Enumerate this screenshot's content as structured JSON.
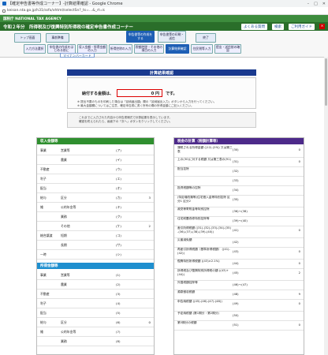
{
  "window": {
    "title": "【確定申告書等作成コーナー】-計算結果確認 - Google Chrome",
    "url": "keisan.nta.go.jp/h31/ssfo/xhtml/selectSn?_ts=...&_rt=k"
  },
  "agency": "国税庁 NATIONAL TAX AGENCY",
  "app": {
    "title": "令和２年分　所得税及び復興特別所得税の確定申告書作成コーナー",
    "faq": "よくある質問",
    "search_label": "検索",
    "help": "ご利用ガイド"
  },
  "steps": {
    "top": [
      "トップ画面",
      "事前準備",
      "申告書等の作成をする",
      "申告書等の印刷・送信",
      "終了"
    ],
    "sub": [
      "入力方法選択",
      "申告書の作成をはじめる前に",
      "収入金額・所得金額の入力",
      "所得控除の入力",
      "税額控除・その他の項目の入力",
      "計算結果確認",
      "住民税等入力",
      "提出・送信前の確認"
    ],
    "mynumber": "マイナンバーカード"
  },
  "result": {
    "header": "計算結果確認",
    "pay_label": "納付する金額は、",
    "pay_amount": "0 円",
    "pay_suffix": "です。",
    "note1": "※ 提出不要のものを印刷した場合は「延納届出額」欄の「延納届出入力」ボタンから入力を行ってください。",
    "note2": "※ 最大金額欄についてはご注意、確定申告書に書く所有の欄の所得金額にご記入ください。",
    "info1": "これまでに入力された内容から申告書様式で計算結果を表示しています。",
    "info2": "確認を終えられたら、画面下の「次へ」ボタンをクリックしてください。"
  },
  "left": {
    "title": "収入金額等",
    "colors": {
      "head": "#2f8f2f"
    },
    "rows": [
      {
        "g": "事業",
        "l": "営業等",
        "c": "(ア)",
        "v": ""
      },
      {
        "g": "",
        "l": "農業",
        "c": "(イ)",
        "v": ""
      },
      {
        "g": "不動産",
        "l": "",
        "c": "(ウ)",
        "v": ""
      },
      {
        "g": "利子",
        "l": "",
        "c": "(エ)",
        "v": ""
      },
      {
        "g": "配当",
        "l": "",
        "c": "(オ)",
        "v": ""
      },
      {
        "g": "給与",
        "l": "区分",
        "c": "(カ)",
        "v": "3"
      },
      {
        "g": "雑",
        "l": "公的年金等",
        "c": "(キ)",
        "v": ""
      },
      {
        "g": "",
        "l": "業務",
        "c": "(ク)",
        "v": ""
      },
      {
        "g": "",
        "l": "その他",
        "c": "(ケ)",
        "v": "2"
      },
      {
        "g": "総合譲渡",
        "l": "短期",
        "c": "(コ)",
        "v": ""
      },
      {
        "g": "",
        "l": "長期",
        "c": "(サ)",
        "v": ""
      },
      {
        "g": "一時",
        "l": "",
        "c": "(シ)",
        "v": ""
      }
    ],
    "income_title": "所得金額等",
    "income_rows": [
      {
        "g": "事業",
        "l": "営業等",
        "c": "(1)",
        "v": ""
      },
      {
        "g": "",
        "l": "農業",
        "c": "(2)",
        "v": ""
      },
      {
        "g": "不動産",
        "l": "",
        "c": "(3)",
        "v": ""
      },
      {
        "g": "利子",
        "l": "",
        "c": "(4)",
        "v": ""
      },
      {
        "g": "配当",
        "l": "",
        "c": "(5)",
        "v": ""
      },
      {
        "g": "給与",
        "l": "区分",
        "c": "(6)",
        "v": "0"
      },
      {
        "g": "雑",
        "l": "公的年金等",
        "c": "(7)",
        "v": ""
      },
      {
        "g": "",
        "l": "業務",
        "c": "(8)",
        "v": ""
      }
    ]
  },
  "right": {
    "title": "税金の計算（税額計算等）",
    "rows": [
      {
        "l": "課税される所得金額 ((12)-(29)) 又は第三表",
        "c": "(30)",
        "v": "0"
      },
      {
        "l": "上の(30)に対する税額 又は第三表の(91)",
        "c": "(31)",
        "v": "0"
      },
      {
        "l": "配当控除",
        "c": "(32)",
        "v": ""
      },
      {
        "l": "",
        "c": "(33)",
        "v": ""
      },
      {
        "l": "投資税額等の控除",
        "c": "(34)",
        "v": ""
      },
      {
        "l": "(特定増改築等)住宅借入金等特別控除 区分1 区分2",
        "c": "(35)",
        "v": ""
      },
      {
        "l": "政党等寄附金等特別控除",
        "c": "(36)〜(38)",
        "v": ""
      },
      {
        "l": "住宅耐震改修特別控除等",
        "c": "(39)〜(40)",
        "v": ""
      },
      {
        "l": "差引所得税額 ((31)-(32)-(33)-(34)-(35) -(36)-(37)-(38)-(39)-(40))",
        "c": "(41)",
        "v": "0"
      },
      {
        "l": "災害減免額",
        "c": "(42)",
        "v": ""
      },
      {
        "l": "再差引所得税額（基準所得税額） ((41)-(42))",
        "c": "(43)",
        "v": "0"
      },
      {
        "l": "復興特別所得税額 ((43)×2.1%)",
        "c": "(44)",
        "v": "0"
      },
      {
        "l": "所得税及び復興特別所得税の額 ((43)+(44))",
        "c": "(45)",
        "v": "2"
      },
      {
        "l": "外国税額控除等",
        "c": "(46)〜(47)",
        "v": ""
      },
      {
        "l": "源泉徴収税額",
        "c": "(48)",
        "v": "9"
      },
      {
        "l": "申告納税額 ((45)-(46)-(47)-(48))",
        "c": "(49)",
        "v": "0"
      },
      {
        "l": "予定納税額 (第1期分・第2期分)",
        "c": "(50)",
        "v": ""
      },
      {
        "l": "第3期分の税額",
        "c": "(51)",
        "v": "0"
      }
    ]
  }
}
